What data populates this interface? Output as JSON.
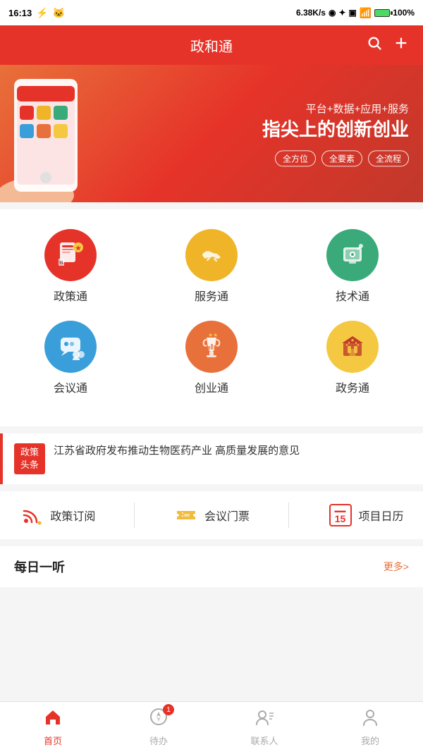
{
  "statusBar": {
    "time": "16:13",
    "network": "6.38K/s",
    "batteryPercent": "100%"
  },
  "header": {
    "title": "政和通",
    "searchLabel": "search",
    "addLabel": "add"
  },
  "banner": {
    "subtitle": "平台+数据+应用+服务",
    "title": "指尖上的创新创业",
    "tags": [
      "全方位",
      "全要素",
      "全流程"
    ]
  },
  "gridItems": [
    {
      "id": 1,
      "label": "政策通",
      "iconType": "policy"
    },
    {
      "id": 2,
      "label": "服务通",
      "iconType": "service"
    },
    {
      "id": 3,
      "label": "技术通",
      "iconType": "tech"
    },
    {
      "id": 4,
      "label": "会议通",
      "iconType": "meeting"
    },
    {
      "id": 5,
      "label": "创业通",
      "iconType": "startup"
    },
    {
      "id": 6,
      "label": "政务通",
      "iconType": "government"
    }
  ],
  "news": {
    "tag": "政策\n头条",
    "content": "江苏省政府发布推动生物医药产业 高质量发展的意见"
  },
  "quickActions": [
    {
      "id": 1,
      "label": "政策订阅",
      "iconType": "rss"
    },
    {
      "id": 2,
      "label": "会议门票",
      "iconType": "ticket"
    },
    {
      "id": 3,
      "label": "项目日历",
      "iconType": "calendar",
      "calendarNum": "15"
    }
  ],
  "dailyListen": {
    "title": "每日一听",
    "moreLabel": "更多>"
  },
  "bottomNav": [
    {
      "id": 1,
      "label": "首页",
      "iconType": "home",
      "active": true,
      "badge": null
    },
    {
      "id": 2,
      "label": "待办",
      "iconType": "compass",
      "active": false,
      "badge": "1"
    },
    {
      "id": 3,
      "label": "联系人",
      "iconType": "contacts",
      "active": false,
      "badge": null
    },
    {
      "id": 4,
      "label": "我的",
      "iconType": "profile",
      "active": false,
      "badge": null
    }
  ]
}
